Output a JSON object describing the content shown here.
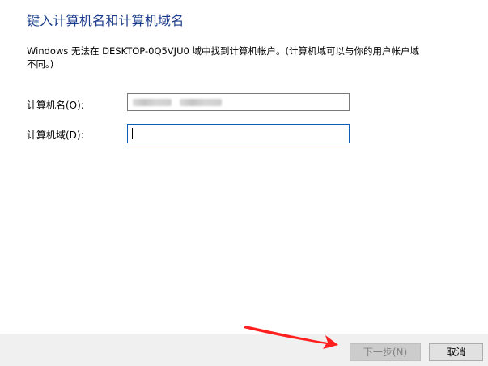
{
  "dialog": {
    "title": "键入计算机名和计算机域名",
    "description": "Windows 无法在 DESKTOP-0Q5VJU0 域中找到计算机帐户。(计算机域可以与你的用户帐户域不同。)"
  },
  "form": {
    "computer_name_label": "计算机名(O):",
    "computer_domain_label": "计算机域(D):",
    "computer_name_value": "",
    "computer_domain_value": ""
  },
  "buttons": {
    "next_label": "下一步(N)",
    "cancel_label": "取消"
  },
  "annotation": {
    "arrow_color": "#ff1f1f"
  }
}
